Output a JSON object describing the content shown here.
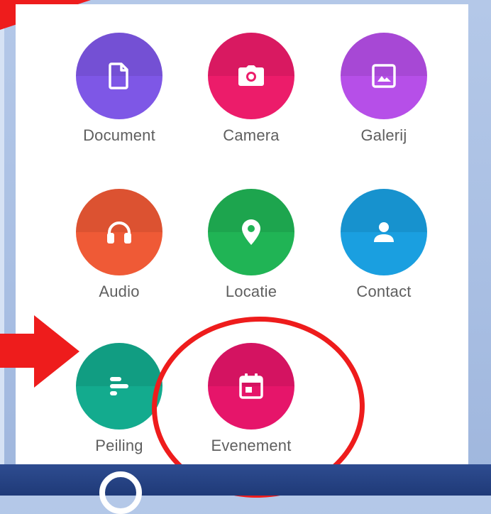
{
  "attach_menu": {
    "items": [
      {
        "label": "Document",
        "icon": "document-icon",
        "color": "#7e57e6"
      },
      {
        "label": "Camera",
        "icon": "camera-icon",
        "color": "#ec1c6a"
      },
      {
        "label": "Galerij",
        "icon": "gallery-icon",
        "color": "#b64fe8"
      },
      {
        "label": "Audio",
        "icon": "headphones-icon",
        "color": "#ef5a36"
      },
      {
        "label": "Locatie",
        "icon": "location-pin-icon",
        "color": "#20b455"
      },
      {
        "label": "Contact",
        "icon": "contact-icon",
        "color": "#1a9fe0"
      },
      {
        "label": "Peiling",
        "icon": "poll-icon",
        "color": "#13ab8e"
      },
      {
        "label": "Evenement",
        "icon": "calendar-icon",
        "color": "#e6156a"
      }
    ]
  },
  "annotation_colors": {
    "arrow": "#ee1c1c",
    "ring": "#ee1c1c"
  }
}
